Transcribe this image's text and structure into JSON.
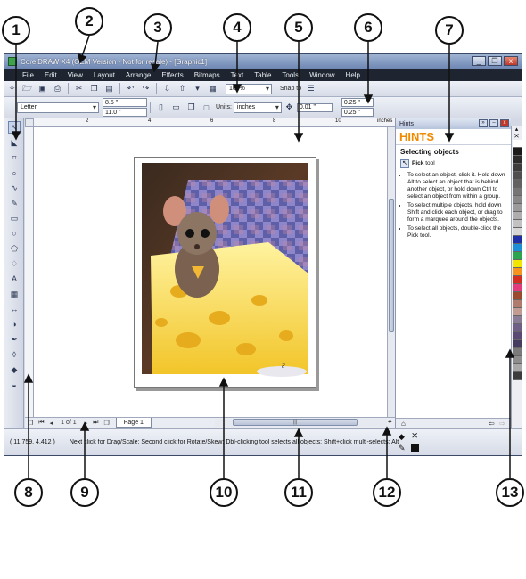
{
  "callouts": [
    "1",
    "2",
    "3",
    "4",
    "5",
    "6",
    "7",
    "8",
    "9",
    "10",
    "11",
    "12",
    "13"
  ],
  "window": {
    "title": "CorelDRAW X4 (OEM Version - Not for resale) - [Graphic1]",
    "buttons": {
      "minimize": "_",
      "restore": "❒",
      "close": "x"
    }
  },
  "menu": [
    "File",
    "Edit",
    "View",
    "Layout",
    "Arrange",
    "Effects",
    "Bitmaps",
    "Text",
    "Table",
    "Tools",
    "Window",
    "Help"
  ],
  "standard_toolbar": {
    "zoom_level": "100%",
    "snap_to": "Snap to"
  },
  "property_bar": {
    "paper_size": "Letter",
    "width": "8.5 \"",
    "height": "11.0 \"",
    "units_label": "Units:",
    "units_value": "inches",
    "nudge": "0.01 \"",
    "dup_x": "0.25 \"",
    "dup_y": "0.25 \""
  },
  "ruler": {
    "units": "inches",
    "top_ticks": [
      "2",
      "4",
      "6",
      "8",
      "10"
    ]
  },
  "toolbox_icons": [
    "pick-tool",
    "shape-tool",
    "crop-tool",
    "zoom-tool",
    "freehand-tool",
    "smart-fill-tool",
    "rectangle-tool",
    "ellipse-tool",
    "polygon-tool",
    "basic-shapes-tool",
    "text-tool",
    "table-tool",
    "parallel-dimension-tool",
    "interactive-blend-tool",
    "eyedropper-tool",
    "outline-tool",
    "fill-tool",
    "interactive-fill-tool"
  ],
  "docker": {
    "tab_label": "Hints",
    "title": "HINTS",
    "heading": "Selecting objects",
    "tool_name": "Pick",
    "tool_suffix": "tool",
    "tips": [
      "To select an object, click it. Hold down Alt to select an object that is behind another object, or hold down Ctrl to select an object from within a group.",
      "To select multiple objects, hold down Shift and click each object, or drag to form a marquee around the objects.",
      "To select all objects, double-click the Pick tool."
    ]
  },
  "page_nav": {
    "page_count": "1 of 1",
    "page_tab": "Page 1"
  },
  "status": {
    "coords": "( 11.759, 4.412 )",
    "message": "Next click for Drag/Scale; Second click for Rotate/Skew; Dbl-clicking tool selects all objects; Shift+click multi-selects; Alt+c..."
  },
  "palette_colors": [
    "#ffffff",
    "#1a1a1a",
    "#2b2b2b",
    "#3d3d3d",
    "#4f4f4f",
    "#626262",
    "#757575",
    "#888888",
    "#9b9b9b",
    "#aeaeae",
    "#c2c2c2",
    "#d6d6d6",
    "#1f2fa8",
    "#1c8fd6",
    "#2da44e",
    "#f2e600",
    "#f7941d",
    "#d62d20",
    "#e23a7a",
    "#9c4a2e",
    "#b07a6e",
    "#c29b93",
    "#8a7c96",
    "#6f5f86",
    "#5a4a74",
    "#463c5f",
    "#7b7b7b",
    "#8e8e8e",
    "#a8a8a8",
    "#3c3c3c"
  ],
  "colors": {
    "accent": "#f08a00",
    "menubar": "#1f2530"
  }
}
